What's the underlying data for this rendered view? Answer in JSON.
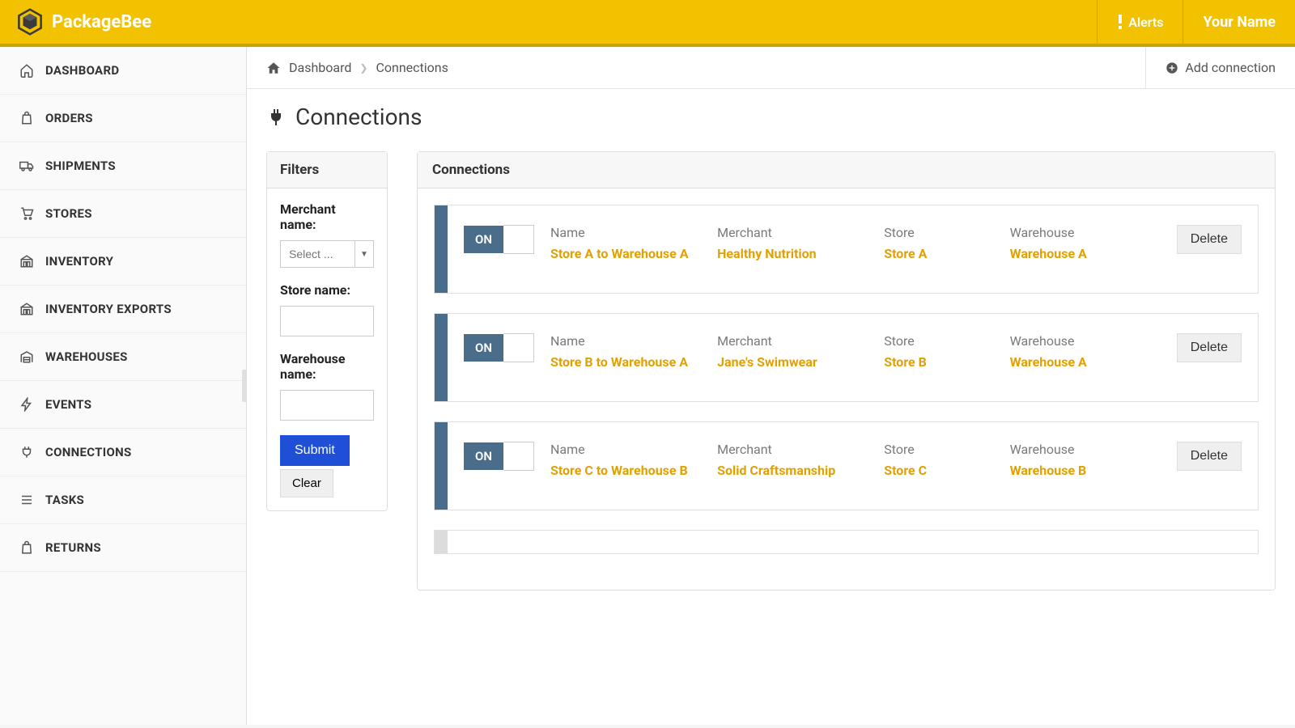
{
  "brand": "PackageBee",
  "header": {
    "alerts_label": "Alerts",
    "username": "Your Name"
  },
  "sidebar": {
    "items": [
      {
        "label": "DASHBOARD",
        "icon": "home"
      },
      {
        "label": "ORDERS",
        "icon": "bag"
      },
      {
        "label": "SHIPMENTS",
        "icon": "truck"
      },
      {
        "label": "STORES",
        "icon": "cart"
      },
      {
        "label": "INVENTORY",
        "icon": "warehouse"
      },
      {
        "label": "INVENTORY EXPORTS",
        "icon": "warehouse"
      },
      {
        "label": "WAREHOUSES",
        "icon": "garage"
      },
      {
        "label": "EVENTS",
        "icon": "bolt"
      },
      {
        "label": "CONNECTIONS",
        "icon": "plug"
      },
      {
        "label": "TASKS",
        "icon": "list"
      },
      {
        "label": "RETURNS",
        "icon": "bag"
      }
    ]
  },
  "breadcrumb": {
    "home": "Dashboard",
    "current": "Connections"
  },
  "add_connection_label": "Add connection",
  "page_title": "Connections",
  "filters": {
    "title": "Filters",
    "merchant_label": "Merchant name:",
    "merchant_placeholder": "Select ...",
    "store_label": "Store name:",
    "warehouse_label": "Warehouse name:",
    "submit_label": "Submit",
    "clear_label": "Clear"
  },
  "connections_panel": {
    "title": "Connections",
    "toggle_on_label": "ON",
    "delete_label": "Delete",
    "col_labels": {
      "name": "Name",
      "merchant": "Merchant",
      "store": "Store",
      "warehouse": "Warehouse"
    },
    "rows": [
      {
        "name": "Store A to Warehouse A",
        "merchant": "Healthy Nutrition",
        "store": "Store A",
        "warehouse": "Warehouse A"
      },
      {
        "name": "Store B to Warehouse A",
        "merchant": "Jane's Swimwear",
        "store": "Store B",
        "warehouse": "Warehouse A"
      },
      {
        "name": "Store C to Warehouse B",
        "merchant": "Solid Craftsmanship",
        "store": "Store C",
        "warehouse": "Warehouse B"
      }
    ]
  }
}
